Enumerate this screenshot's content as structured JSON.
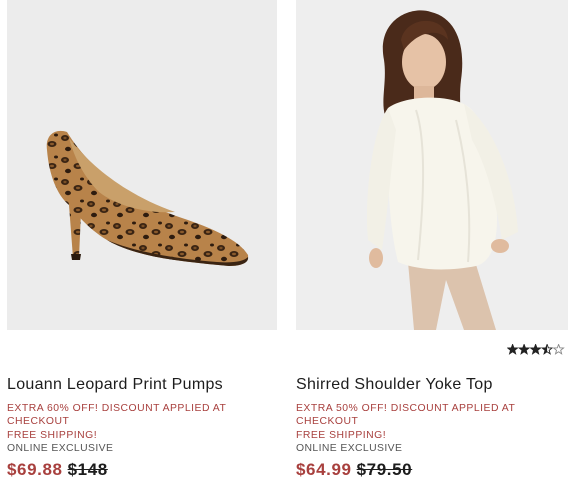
{
  "products": [
    {
      "name": "Louann Leopard Print Pumps",
      "promo": "Extra 60% Off! Discount Applied At Checkout",
      "shipping": "Free Shipping!",
      "badge": "Online Exclusive",
      "sale_price": "$69.88",
      "original_price": "$148",
      "image": "leopard-pump-image"
    },
    {
      "name": "Shirred Shoulder Yoke Top",
      "promo": "Extra 50% Off! Discount Applied At Checkout",
      "shipping": "Free Shipping!",
      "badge": "Online Exclusive",
      "sale_price": "$64.99",
      "original_price": "$79.50",
      "image": "model-ivory-top-image",
      "rating": 3.5,
      "rating_max": 5
    }
  ],
  "colors": {
    "sale": "#a8403e",
    "image_bg": "#ececec"
  }
}
